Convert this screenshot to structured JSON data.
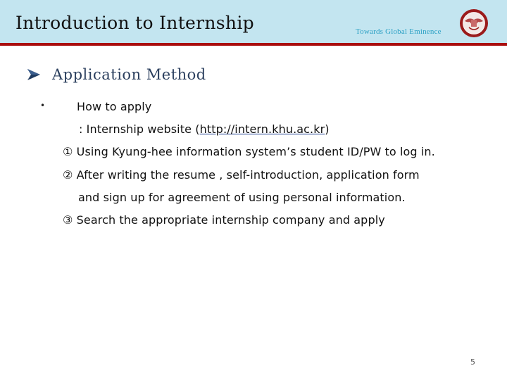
{
  "header": {
    "title": "Introduction to Internship",
    "tagline": "Towards Global Eminence",
    "logo": "university-seal-icon",
    "colors": {
      "band": "#c3e5f0",
      "rule": "#a90d0d",
      "tagline": "#2aa0c4"
    }
  },
  "section": {
    "marker": "arrow-bullet-icon",
    "heading": "Application Method"
  },
  "content": {
    "bullet": "•",
    "subheading": "How to apply",
    "website_prefix": ":  Internship website (",
    "website_link": "http://intern.khu.ac.kr",
    "website_suffix": ")",
    "steps": [
      {
        "marker": "①",
        "text": " Using Kyung-hee information system’s student ID/PW to log in."
      },
      {
        "marker": "②",
        "text": " After writing the resume , self-introduction, application form"
      },
      {
        "marker": "",
        "text": "and sign up for agreement of using personal information."
      },
      {
        "marker": "③",
        "text": " Search the appropriate internship company and apply"
      }
    ]
  },
  "footer": {
    "page_number": "5"
  }
}
